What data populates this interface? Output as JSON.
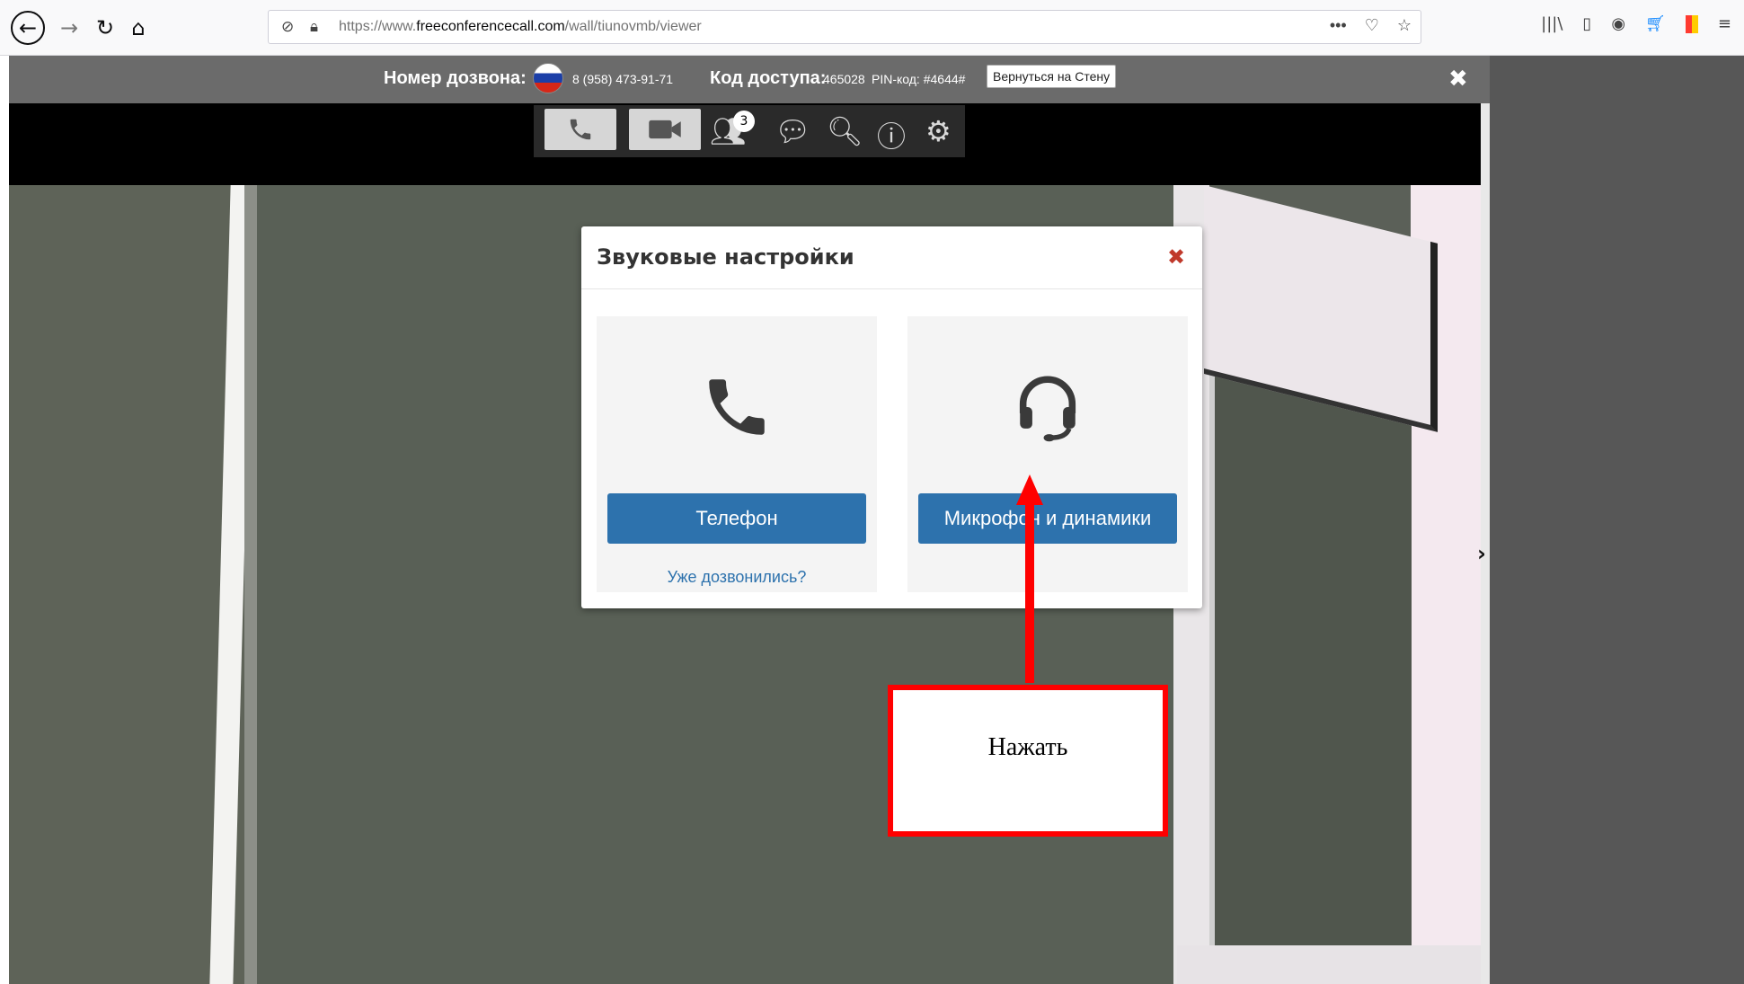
{
  "browser": {
    "url_prefix": "https://www.",
    "url_host": "freeconferencecall.com",
    "url_path": "/wall/tiunovmb/viewer",
    "nav_icons": [
      "back-arrow-icon",
      "forward-arrow-icon",
      "reload-icon",
      "home-icon"
    ],
    "url_icons": [
      "tracking-shield-icon",
      "lock-icon"
    ],
    "url_actions": [
      "more-icon",
      "pocket-icon",
      "bookmark-star-icon"
    ],
    "toolbar_icons": [
      "library-icon",
      "sidebar-icon",
      "account-icon",
      "cart-icon",
      "bookmark-flag-icon",
      "menu-icon"
    ]
  },
  "conference": {
    "dial_label": "Номер дозвона:",
    "dial_number": "8 (958) 473-91-71",
    "access_label": "Код доступа:",
    "access_code": "465028",
    "pin_text": "PIN-код: #4644#",
    "back_button": "Вернуться на Стену",
    "participant_count": "3"
  },
  "modal": {
    "title": "Звуковые настройки",
    "phone_button": "Телефон",
    "already_link": "Уже дозвонились?",
    "mic_button": "Микрофон и динамики"
  },
  "annotation": {
    "callout_text": "Нажать",
    "color": "#ff0000"
  }
}
